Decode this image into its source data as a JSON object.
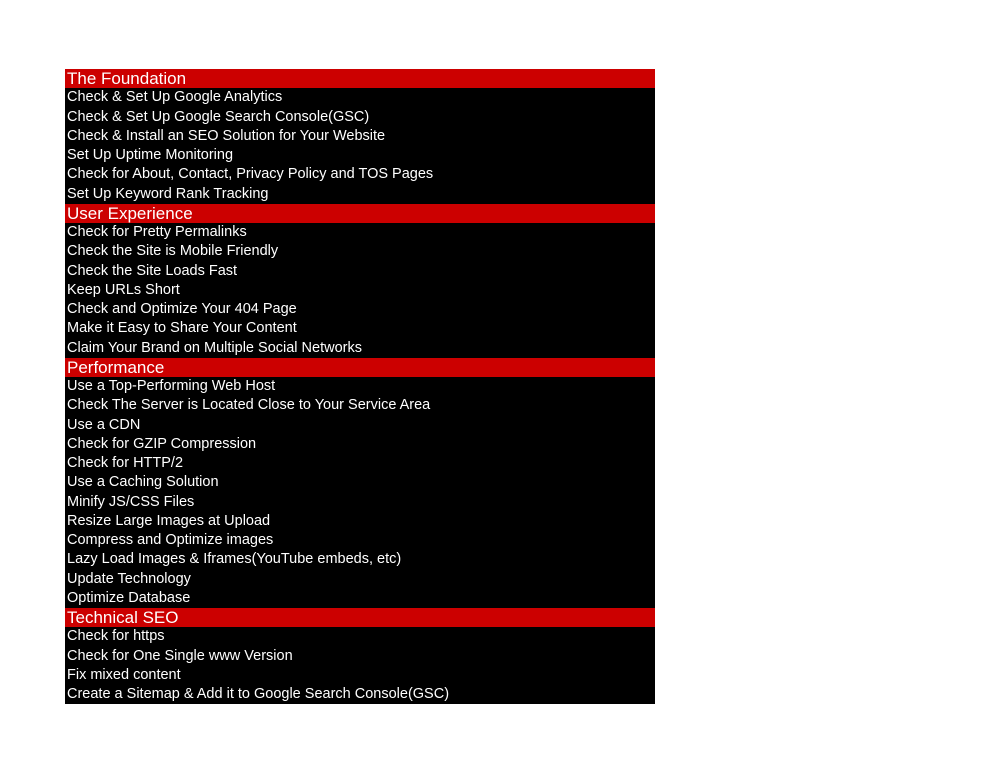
{
  "colors": {
    "section_bg": "#cc0000",
    "item_bg": "#000000",
    "text": "#ffffff"
  },
  "sections": [
    {
      "title": "The Foundation",
      "items": [
        "Check & Set Up Google Analytics",
        "Check & Set Up Google Search Console(GSC)",
        "Check & Install an SEO Solution for Your Website",
        "Set Up Uptime Monitoring",
        "Check for About, Contact, Privacy Policy and TOS Pages",
        "Set Up Keyword Rank Tracking"
      ]
    },
    {
      "title": "User Experience",
      "items": [
        "Check for Pretty Permalinks",
        "Check the Site is Mobile Friendly",
        "Check the Site Loads Fast",
        "Keep URLs Short",
        "Check and Optimize Your 404 Page",
        "Make it Easy to Share Your Content",
        "Claim Your Brand on Multiple Social Networks"
      ]
    },
    {
      "title": "Performance",
      "items": [
        "Use a Top-Performing Web Host",
        "Check The Server is Located Close to Your Service Area",
        "Use a CDN",
        "Check for GZIP Compression",
        "Check for HTTP/2",
        "Use a Caching Solution",
        "Minify JS/CSS Files",
        "Resize Large Images at Upload",
        "Compress and Optimize images",
        "Lazy Load Images & Iframes(YouTube embeds, etc)",
        "Update Technology",
        "Optimize Database"
      ]
    },
    {
      "title": "Technical SEO",
      "items": [
        "Check for https",
        "Check for One Single www Version",
        "Fix mixed content",
        "Create a Sitemap & Add it to Google Search Console(GSC)"
      ]
    }
  ]
}
